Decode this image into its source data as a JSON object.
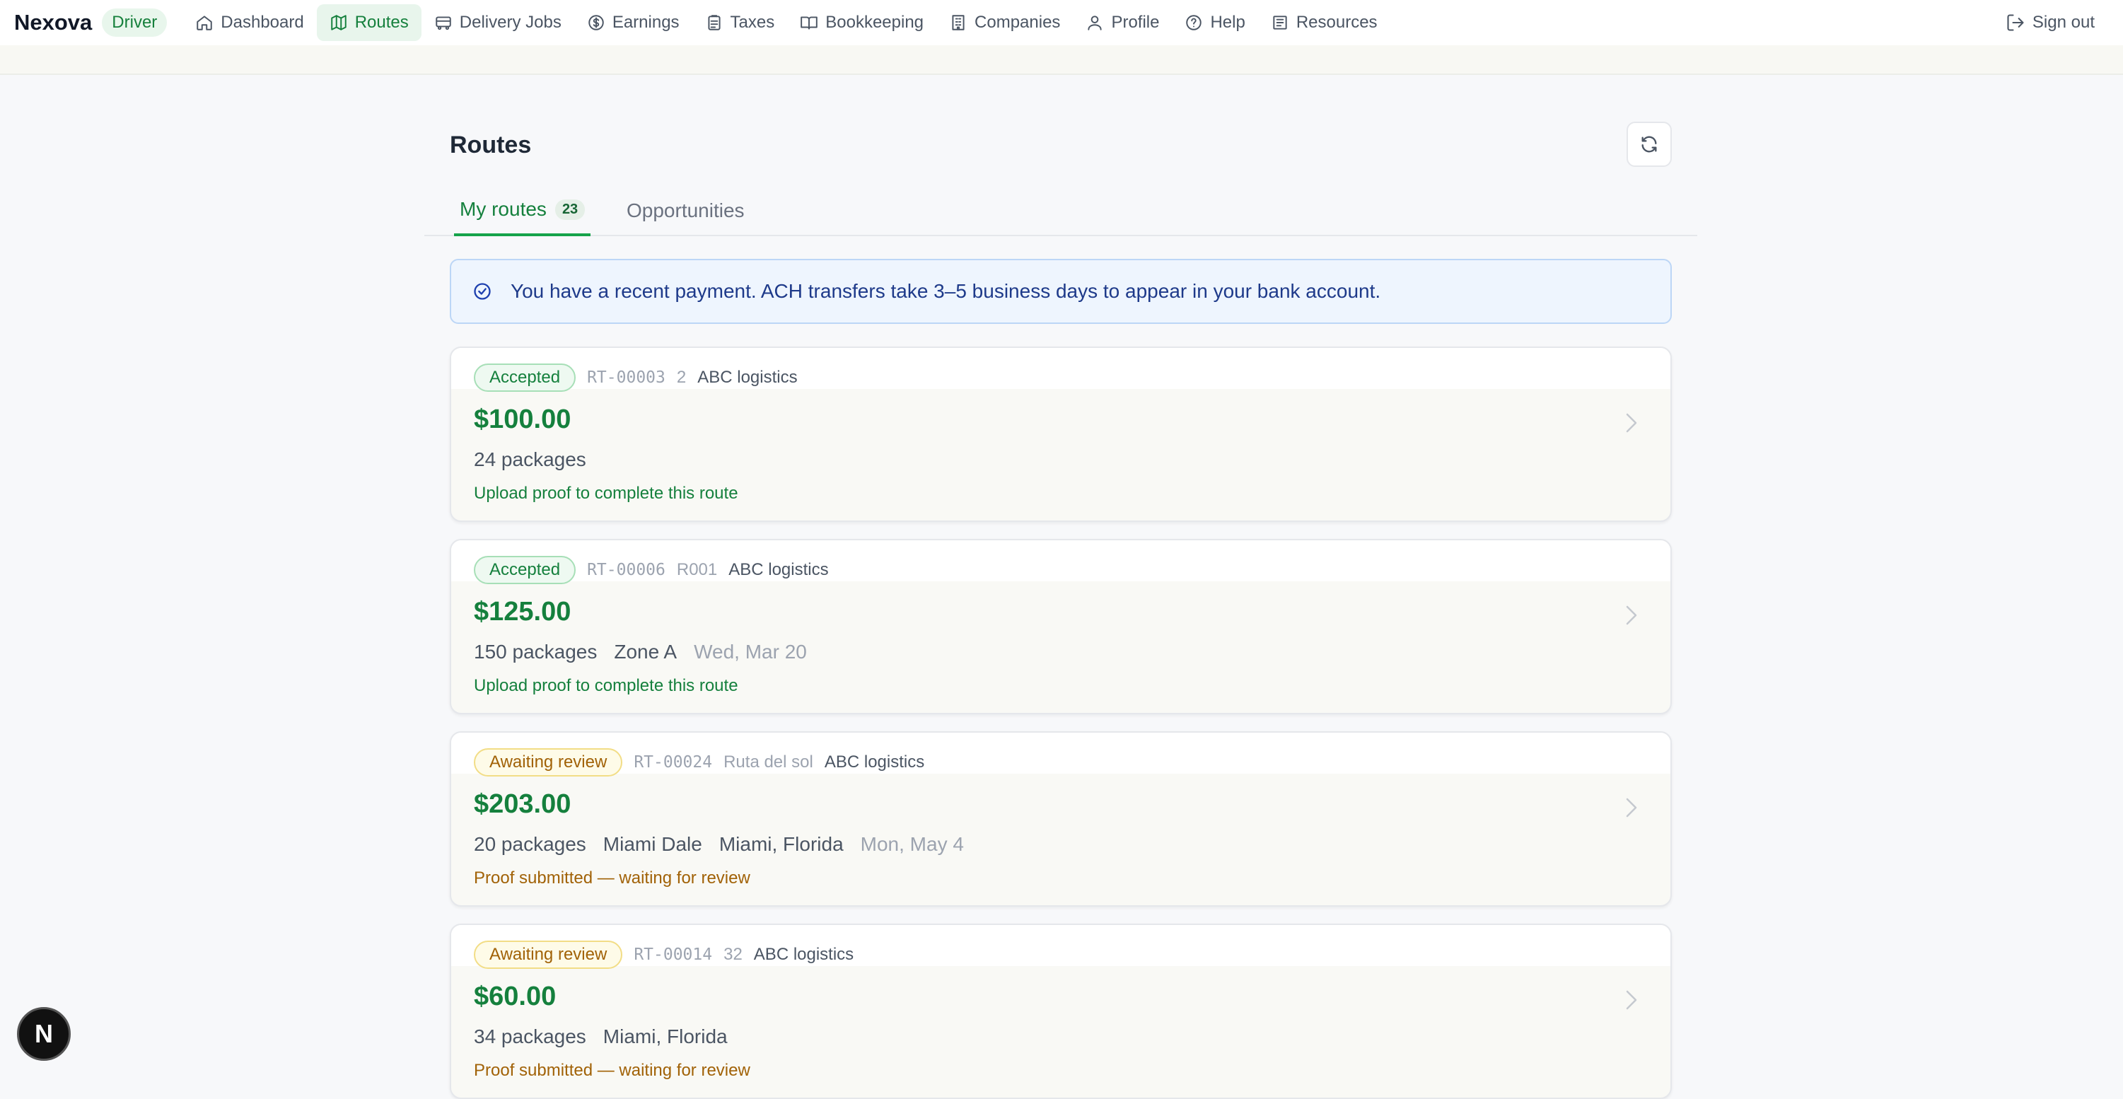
{
  "brand": {
    "name": "Nexova",
    "role": "Driver"
  },
  "nav": {
    "items": [
      {
        "label": "Dashboard",
        "icon": "home-icon"
      },
      {
        "label": "Routes",
        "icon": "map-icon",
        "active": true
      },
      {
        "label": "Delivery Jobs",
        "icon": "truck-icon"
      },
      {
        "label": "Earnings",
        "icon": "dollar-icon"
      },
      {
        "label": "Taxes",
        "icon": "clipboard-icon"
      },
      {
        "label": "Bookkeeping",
        "icon": "book-icon"
      },
      {
        "label": "Companies",
        "icon": "building-icon"
      },
      {
        "label": "Profile",
        "icon": "user-icon"
      },
      {
        "label": "Help",
        "icon": "help-icon"
      },
      {
        "label": "Resources",
        "icon": "newspaper-icon"
      }
    ],
    "signout": "Sign out"
  },
  "page": {
    "title": "Routes",
    "tabs": [
      {
        "label": "My routes",
        "count": "23",
        "active": true
      },
      {
        "label": "Opportunities"
      }
    ],
    "notice": "You have a recent payment. ACH transfers take 3–5 business days to appear in your bank account."
  },
  "routes": [
    {
      "status": "Accepted",
      "route_id": "RT-00003",
      "ref": "2",
      "company": "ABC logistics",
      "amount": "$100.00",
      "packages": "24 packages",
      "zone": "",
      "location": "",
      "date": "",
      "action": "Upload proof to complete this route"
    },
    {
      "status": "Accepted",
      "route_id": "RT-00006",
      "ref": "R001",
      "company": "ABC logistics",
      "amount": "$125.00",
      "packages": "150 packages",
      "zone": "Zone A",
      "location": "",
      "date": "Wed, Mar 20",
      "action": "Upload proof to complete this route"
    },
    {
      "status": "Awaiting review",
      "route_id": "RT-00024",
      "ref": "Ruta del sol",
      "company": "ABC logistics",
      "amount": "$203.00",
      "packages": "20 packages",
      "zone": "Miami Dale",
      "location": "Miami, Florida",
      "date": "Mon, May 4",
      "action": "Proof submitted — waiting for review"
    },
    {
      "status": "Awaiting review",
      "route_id": "RT-00014",
      "ref": "32",
      "company": "ABC logistics",
      "amount": "$60.00",
      "packages": "34 packages",
      "zone": "Miami, Florida",
      "location": "",
      "date": "",
      "action": "Proof submitted — waiting for review"
    }
  ],
  "fab": {
    "label": "N"
  }
}
